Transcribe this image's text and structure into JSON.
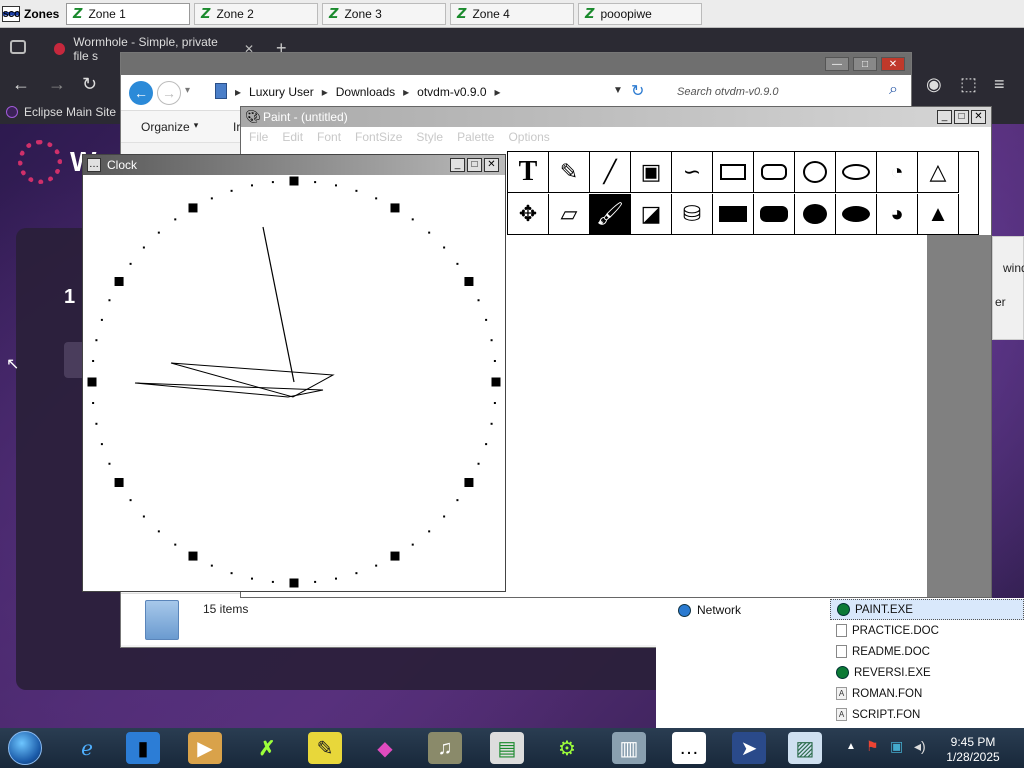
{
  "zones_bar": {
    "start_label": "Zones",
    "logo_text": "SCO",
    "tabs": [
      {
        "label": "Zone 1"
      },
      {
        "label": "Zone 2"
      },
      {
        "label": "Zone 3"
      },
      {
        "label": "Zone 4"
      },
      {
        "label": "pooopiwe"
      }
    ]
  },
  "browser": {
    "tab_title": "Wormhole - Simple, private file s",
    "bookmark": "Eclipse Main Site",
    "page_fragments": {
      "big_letter": "W",
      "number": "1",
      "side_text_1": "wind",
      "side_text_2": "er"
    }
  },
  "explorer": {
    "breadcrumb": [
      "Luxury User",
      "Downloads",
      "otvdm-v0.9.0"
    ],
    "search_placeholder": "Search otvdm-v0.9.0",
    "organize_label": "Organize",
    "cmd_fragment": "Ir",
    "status_count": "15 items",
    "nav_item": "Network",
    "files": [
      {
        "name": "PAINT.EXE",
        "icon": "exe-icon",
        "selected": true
      },
      {
        "name": "PRACTICE.DOC",
        "icon": "doc-icon",
        "selected": false
      },
      {
        "name": "README.DOC",
        "icon": "doc-icon",
        "selected": false
      },
      {
        "name": "REVERSI.EXE",
        "icon": "exe-icon",
        "selected": false
      },
      {
        "name": "ROMAN.FON",
        "icon": "fon-icon",
        "selected": false
      },
      {
        "name": "SCRIPT.FON",
        "icon": "fon-icon",
        "selected": false
      }
    ]
  },
  "paint": {
    "title": "Paint - (untitled)",
    "menu": [
      "File",
      "Edit",
      "Font",
      "FontSize",
      "Style",
      "Palette",
      "Options"
    ],
    "tools_row1": [
      "text-tool-icon",
      "brush-tool-icon",
      "line-tool-icon",
      "cube-tool-icon",
      "curve-tool-icon",
      "rectangle-tool-icon",
      "rounded-rect-tool-icon",
      "circle-tool-icon",
      "oval-tool-icon",
      "pie-tool-icon",
      "triangle-tool-icon"
    ],
    "tools_row2": [
      "move-tool-icon",
      "eraser-tool-icon",
      "paintbrush-tool-icon",
      "fill-tool-icon",
      "spray-tool-icon",
      "filled-rect-tool-icon",
      "filled-rounded-rect-tool-icon",
      "filled-circle-tool-icon",
      "filled-oval-tool-icon",
      "filled-pie-tool-icon",
      "filled-triangle-tool-icon"
    ],
    "selected_tool": "paintbrush-tool-icon"
  },
  "clock": {
    "title": "Clock"
  },
  "taskbar": {
    "time": "9:45 PM",
    "date": "1/28/2025"
  }
}
